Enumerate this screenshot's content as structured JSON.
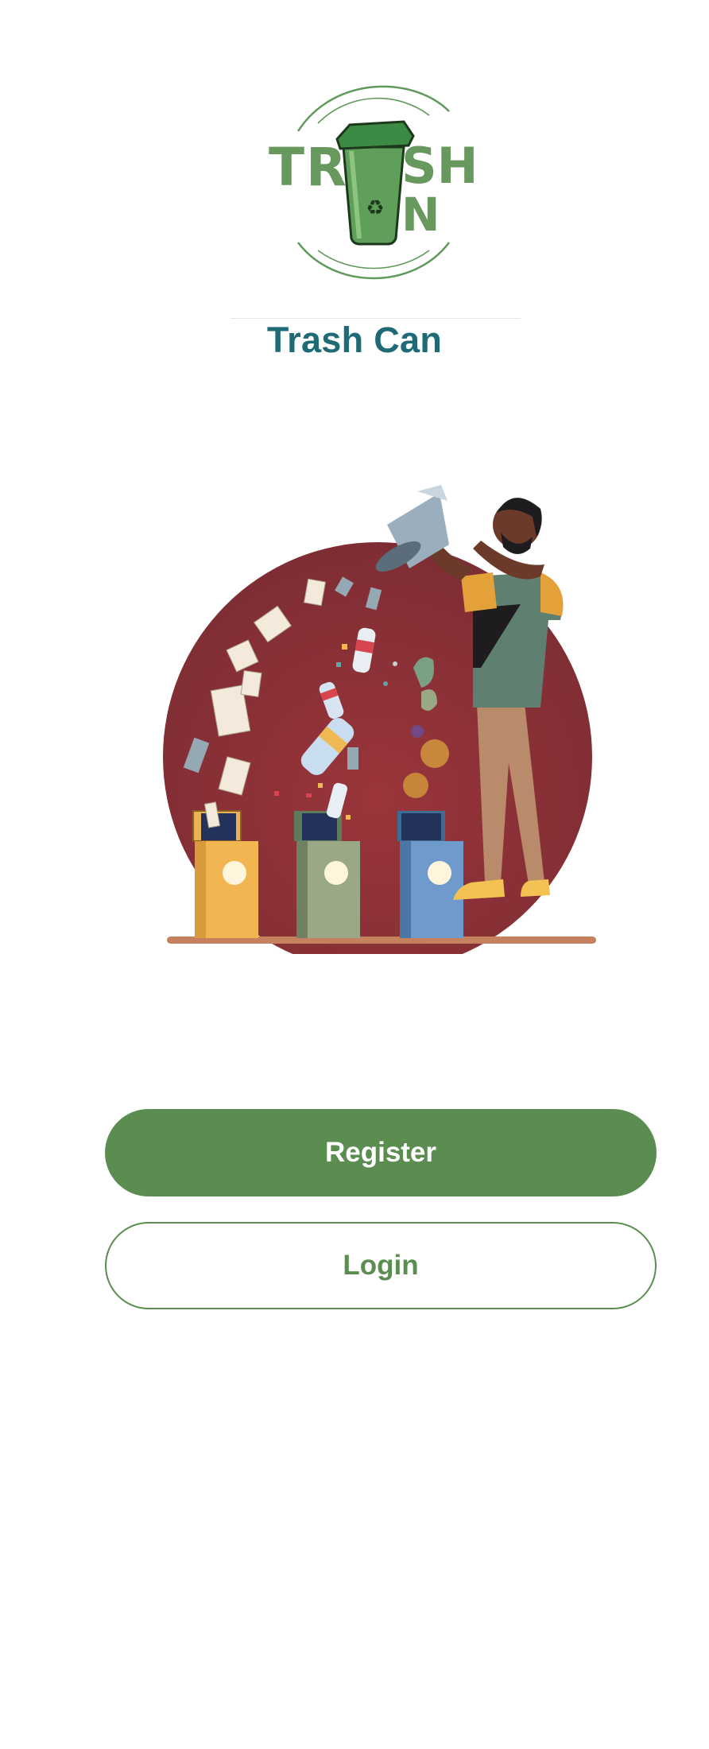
{
  "app": {
    "title": "Trash Can",
    "logo_text_left": "TR",
    "logo_text_right": "SH",
    "logo_text_bottom": "N"
  },
  "illustration": {
    "icon": "recycling-illustration"
  },
  "actions": {
    "register_label": "Register",
    "login_label": "Login"
  },
  "colors": {
    "primary": "#5b8d50",
    "title": "#1f6b75",
    "background": "#ffffff",
    "illustration_circle": "#8a3138"
  }
}
